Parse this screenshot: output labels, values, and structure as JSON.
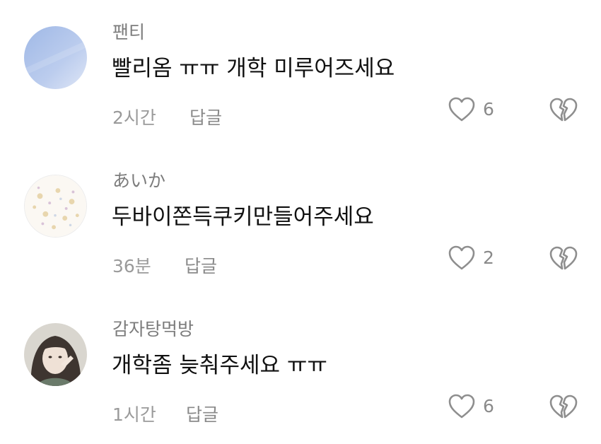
{
  "icons": {
    "like": "heart-outline-icon",
    "dislike": "broken-heart-icon"
  },
  "colors": {
    "text": "#111111",
    "muted": "#8a8a8a",
    "icon": "#8e8e8e"
  },
  "comments": [
    {
      "author": "팬티",
      "text": "빨리옴 ㅠㅠ 개학 미루어즈세요",
      "time": "2시간",
      "reply": "답글",
      "likes": "6"
    },
    {
      "author": "あいか",
      "text": "두바이쫀득쿠키만들어주세요",
      "time": "36분",
      "reply": "답글",
      "likes": "2"
    },
    {
      "author": "감자탕먹방",
      "text": "개학좀 늦춰주세요 ㅠㅠ",
      "time": "1시간",
      "reply": "답글",
      "likes": "6"
    }
  ]
}
